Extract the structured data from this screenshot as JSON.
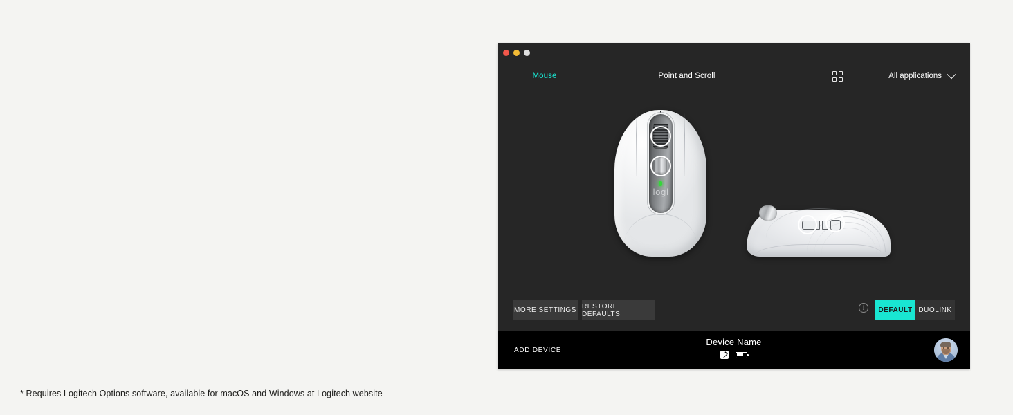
{
  "page": {
    "background_color": "#f4f4f2",
    "footnote": "* Requires Logitech Options software, available for macOS and Windows at Logitech website"
  },
  "window": {
    "background_color": "#262626",
    "accent_color": "#19e6d2",
    "title_bar": {
      "traffic_lights": [
        {
          "name": "close",
          "color": "#f2574b"
        },
        {
          "name": "minimize",
          "color": "#f3bb35"
        },
        {
          "name": "maximize",
          "color": "#dedede"
        }
      ]
    },
    "nav": {
      "tabs": [
        {
          "label": "Mouse",
          "active": true
        },
        {
          "label": "Point and Scroll",
          "active": false
        }
      ],
      "grid_icon": "grid-apps-icon",
      "application_selector": {
        "label": "All applications",
        "chevron": "chevron-down-icon"
      }
    },
    "stage": {
      "device_top_view": {
        "alt": "Logitech MX Anywhere 3 mouse, top view, pale grey",
        "logo_text": "logi",
        "led_color": "#35d63a"
      },
      "device_side_view": {
        "alt": "Logitech MX Anywhere 3 mouse, side profile view, pale grey"
      }
    },
    "action_bar": {
      "more_settings_label": "MORE SETTINGS",
      "restore_defaults_label": "RESTORE DEFAULTS",
      "info_icon": "info-circle-icon",
      "info_glyph": "i",
      "modes": [
        {
          "label": "DEFAULT",
          "selected": true,
          "color": "#19e6d2"
        },
        {
          "label": "DUOLINK",
          "selected": false,
          "color": "#333333"
        }
      ]
    },
    "device_bar": {
      "background_color": "#000000",
      "add_device_label": "ADD DEVICE",
      "device_name": "Device Name",
      "status_icons": [
        {
          "name": "bluetooth-icon"
        },
        {
          "name": "battery-icon"
        }
      ],
      "avatar": {
        "name": "user-avatar",
        "alt": "User profile photo"
      }
    }
  }
}
